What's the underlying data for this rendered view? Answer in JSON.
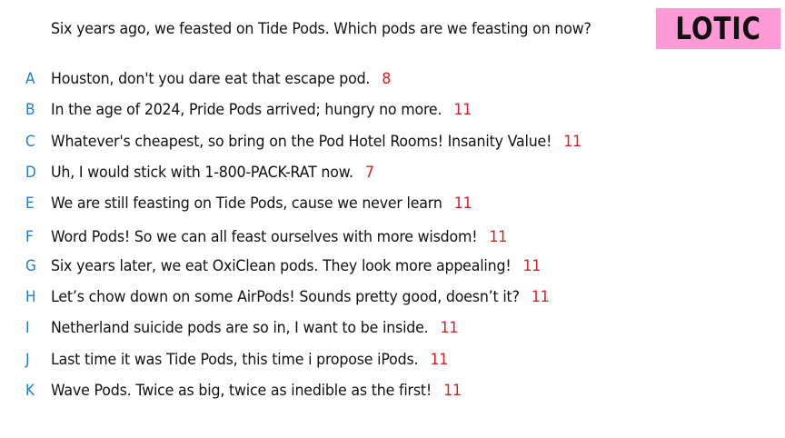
{
  "question": "Six years ago, we feasted on Tide Pods. Which pods are we feasting on now?",
  "badge": "LOTIC",
  "colors": {
    "letter": "#1e7fd6",
    "count": "#d61f26",
    "badge_bg": "#ff9ad6",
    "text": "#111111"
  },
  "answers": [
    {
      "letter": "A",
      "text": "Houston, don't you dare eat that escape pod.",
      "count": "8"
    },
    {
      "letter": "B",
      "text": "In the age of 2024, Pride Pods arrived; hungry no more.",
      "count": "11"
    },
    {
      "letter": "C",
      "text": "Whatever's cheapest, so bring on the Pod Hotel Rooms! Insanity Value!",
      "count": "11"
    },
    {
      "letter": "D",
      "text": "Uh, I would stick with 1-800-PACK-RAT now.",
      "count": "7"
    },
    {
      "letter": "E",
      "text": "We are still feasting on Tide Pods, cause we never learn",
      "count": "11"
    },
    {
      "letter": "F",
      "text": "Word Pods! So we can all feast ourselves with more wisdom!",
      "count": "11"
    },
    {
      "letter": "G",
      "text": "Six years later, we eat OxiClean pods. They look more appealing!",
      "count": "11"
    },
    {
      "letter": "H",
      "text": "Let’s chow down on some AirPods! Sounds pretty good, doesn’t it?",
      "count": "11"
    },
    {
      "letter": "I",
      "text": "Netherland suicide pods are so in, I want to be inside.",
      "count": "11"
    },
    {
      "letter": "J",
      "text": "Last time it was Tide Pods, this time i propose iPods.",
      "count": "11"
    },
    {
      "letter": "K",
      "text": "Wave Pods. Twice as big, twice as inedible as the first!",
      "count": "11"
    }
  ]
}
